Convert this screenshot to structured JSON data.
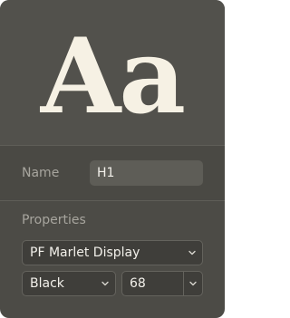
{
  "preview": {
    "sample_text": "Aa"
  },
  "name_row": {
    "label": "Name",
    "value": "H1"
  },
  "properties": {
    "label": "Properties",
    "font_family": "PF Marlet Display",
    "font_weight": "Black",
    "font_size": "68"
  },
  "icons": {
    "dropdown": "chevron-down-icon"
  },
  "colors": {
    "panel_background": "#4c4b46",
    "preview_text": "#f6f1e4",
    "label_text": "#a7a59e",
    "field_background": "#3f3e3a"
  }
}
